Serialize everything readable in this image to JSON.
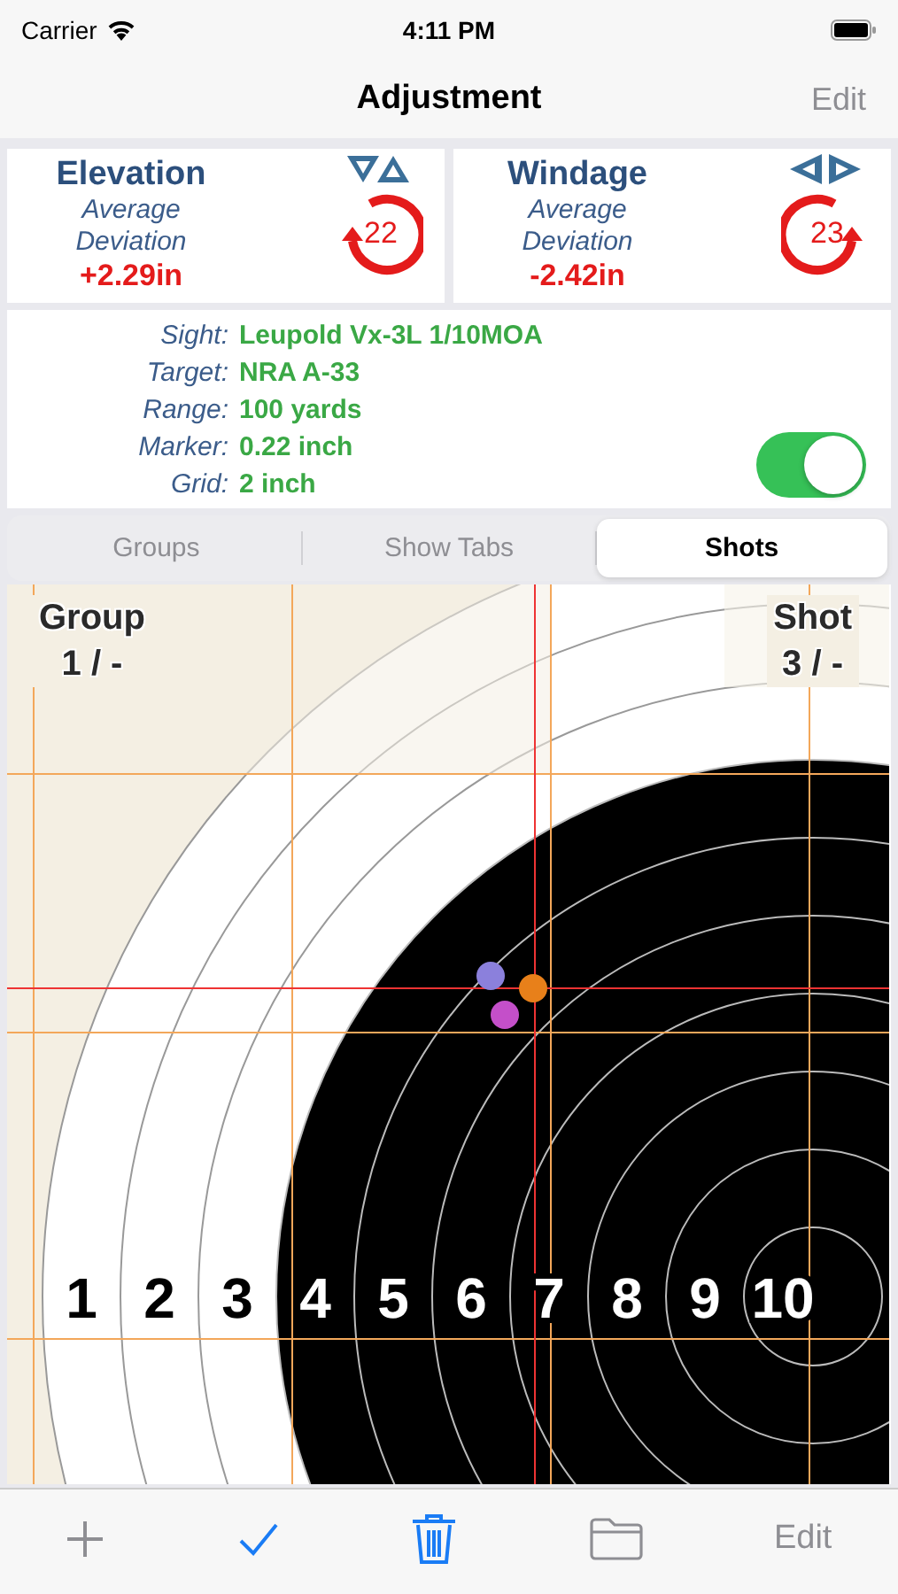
{
  "status_bar": {
    "carrier": "Carrier",
    "time": "4:11 PM"
  },
  "nav": {
    "title": "Adjustment",
    "edit": {
      "label": "Edit",
      "disabled": true
    }
  },
  "adjustments": [
    {
      "kind": "elevation",
      "title": "Elevation",
      "subtitle": "Average Deviation",
      "value": "+2.29in",
      "clicks": "22"
    },
    {
      "kind": "windage",
      "title": "Windage",
      "subtitle": "Average Deviation",
      "value": "-2.42in",
      "clicks": "23"
    }
  ],
  "info": [
    {
      "label": "Sight:",
      "value": "Leupold Vx-3L 1/10MOA"
    },
    {
      "label": "Target:",
      "value": "NRA A-33"
    },
    {
      "label": "Range:",
      "value": "100 yards"
    },
    {
      "label": "Marker:",
      "value": "0.22 inch"
    },
    {
      "label": "Grid:",
      "value": "2 inch"
    }
  ],
  "toggle": {
    "on": true
  },
  "segments": [
    {
      "label": "Groups",
      "selected": false
    },
    {
      "label": "Show Tabs",
      "selected": false
    },
    {
      "label": "Shots",
      "selected": true
    }
  ],
  "target": {
    "group_label": {
      "title": "Group",
      "value": "1 / -"
    },
    "shot_label": {
      "title": "Shot",
      "value": "3 / -"
    },
    "ring_labels": [
      "1",
      "2",
      "3",
      "4",
      "5",
      "6",
      "7",
      "8",
      "9",
      "10"
    ],
    "shots": [
      {
        "color": "#8b80dc"
      },
      {
        "color": "#e8801a"
      },
      {
        "color": "#c44fc9"
      }
    ]
  },
  "toolbar": [
    {
      "kind": "add",
      "disabled": true
    },
    {
      "kind": "check",
      "disabled": false
    },
    {
      "kind": "trash",
      "disabled": false
    },
    {
      "kind": "folder",
      "disabled": true
    },
    {
      "kind": "text",
      "label": "Edit",
      "disabled": true
    }
  ]
}
